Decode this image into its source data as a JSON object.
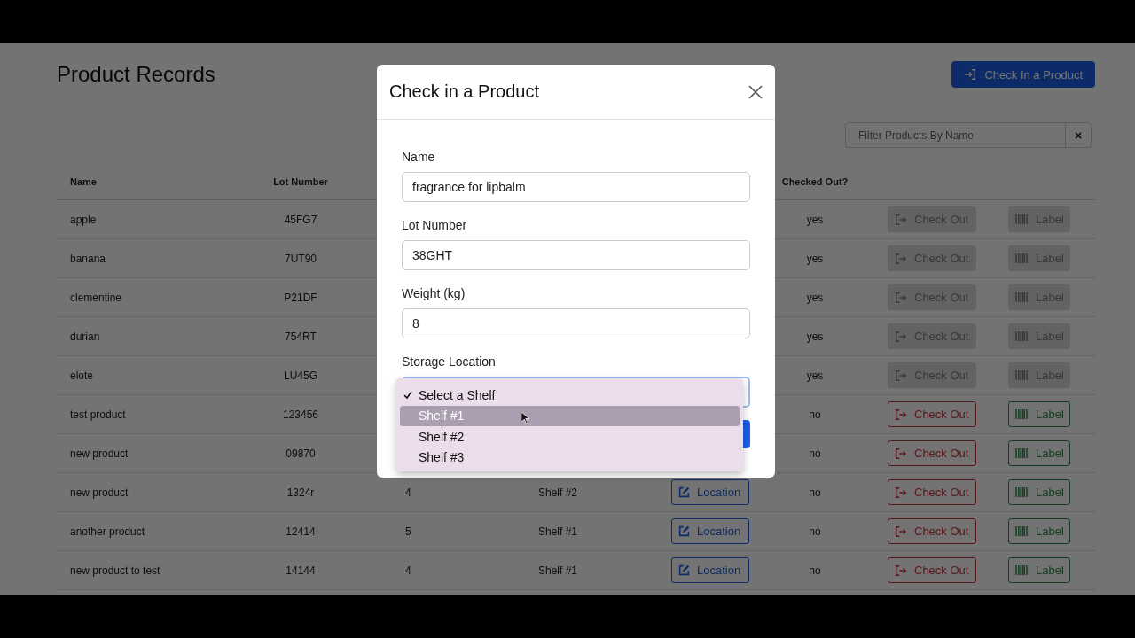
{
  "page": {
    "title": "Product Records",
    "check_in_button": "Check In a Product",
    "filter": {
      "placeholder": "Filter Products By Name",
      "clear": "×"
    }
  },
  "table": {
    "columns": [
      "Name",
      "Lot Number",
      "Checked Out?"
    ],
    "rows": [
      {
        "name": "apple",
        "lot": "45FG7",
        "checked_out": "yes",
        "disabled": true,
        "check_out": "Check Out",
        "label": "Label"
      },
      {
        "name": "banana",
        "lot": "7UT90",
        "checked_out": "yes",
        "disabled": true,
        "check_out": "Check Out",
        "label": "Label"
      },
      {
        "name": "clementine",
        "lot": "P21DF",
        "checked_out": "yes",
        "disabled": true,
        "check_out": "Check Out",
        "label": "Label"
      },
      {
        "name": "durian",
        "lot": "754RT",
        "checked_out": "yes",
        "disabled": true,
        "check_out": "Check Out",
        "label": "Label"
      },
      {
        "name": "elote",
        "lot": "LU45G",
        "checked_out": "yes",
        "disabled": true,
        "check_out": "Check Out",
        "label": "Label"
      },
      {
        "name": "test product",
        "lot": "123456",
        "checked_out": "no",
        "disabled": false,
        "check_out": "Check Out",
        "label": "Label"
      },
      {
        "name": "new product",
        "lot": "09870",
        "checked_out": "no",
        "disabled": false,
        "check_out": "Check Out",
        "label": "Label"
      },
      {
        "name": "new product",
        "lot": "1324r",
        "weight": "4",
        "shelf": "Shelf #2",
        "location": "Location",
        "checked_out": "no",
        "disabled": false,
        "check_out": "Check Out",
        "label": "Label"
      },
      {
        "name": "another product",
        "lot": "12414",
        "weight": "5",
        "shelf": "Shelf #1",
        "location": "Location",
        "checked_out": "no",
        "disabled": false,
        "check_out": "Check Out",
        "label": "Label"
      },
      {
        "name": "new product to test",
        "lot": "14144",
        "weight": "4",
        "shelf": "Shelf #1",
        "location": "Location",
        "checked_out": "no",
        "disabled": false,
        "check_out": "Check Out",
        "label": "Label"
      }
    ]
  },
  "modal": {
    "title": "Check in a Product",
    "fields": [
      {
        "label": "Name",
        "value": "fragrance for lipbalm"
      },
      {
        "label": "Lot Number",
        "value": "38GHT"
      },
      {
        "label": "Weight (kg)",
        "value": "8"
      }
    ],
    "storage_label": "Storage Location",
    "options": [
      {
        "label": "Select a Shelf",
        "selected": true,
        "highlighted": false
      },
      {
        "label": "Shelf #1",
        "selected": false,
        "highlighted": true
      },
      {
        "label": "Shelf #2",
        "selected": false,
        "highlighted": false
      },
      {
        "label": "Shelf #3",
        "selected": false,
        "highlighted": false
      }
    ]
  }
}
